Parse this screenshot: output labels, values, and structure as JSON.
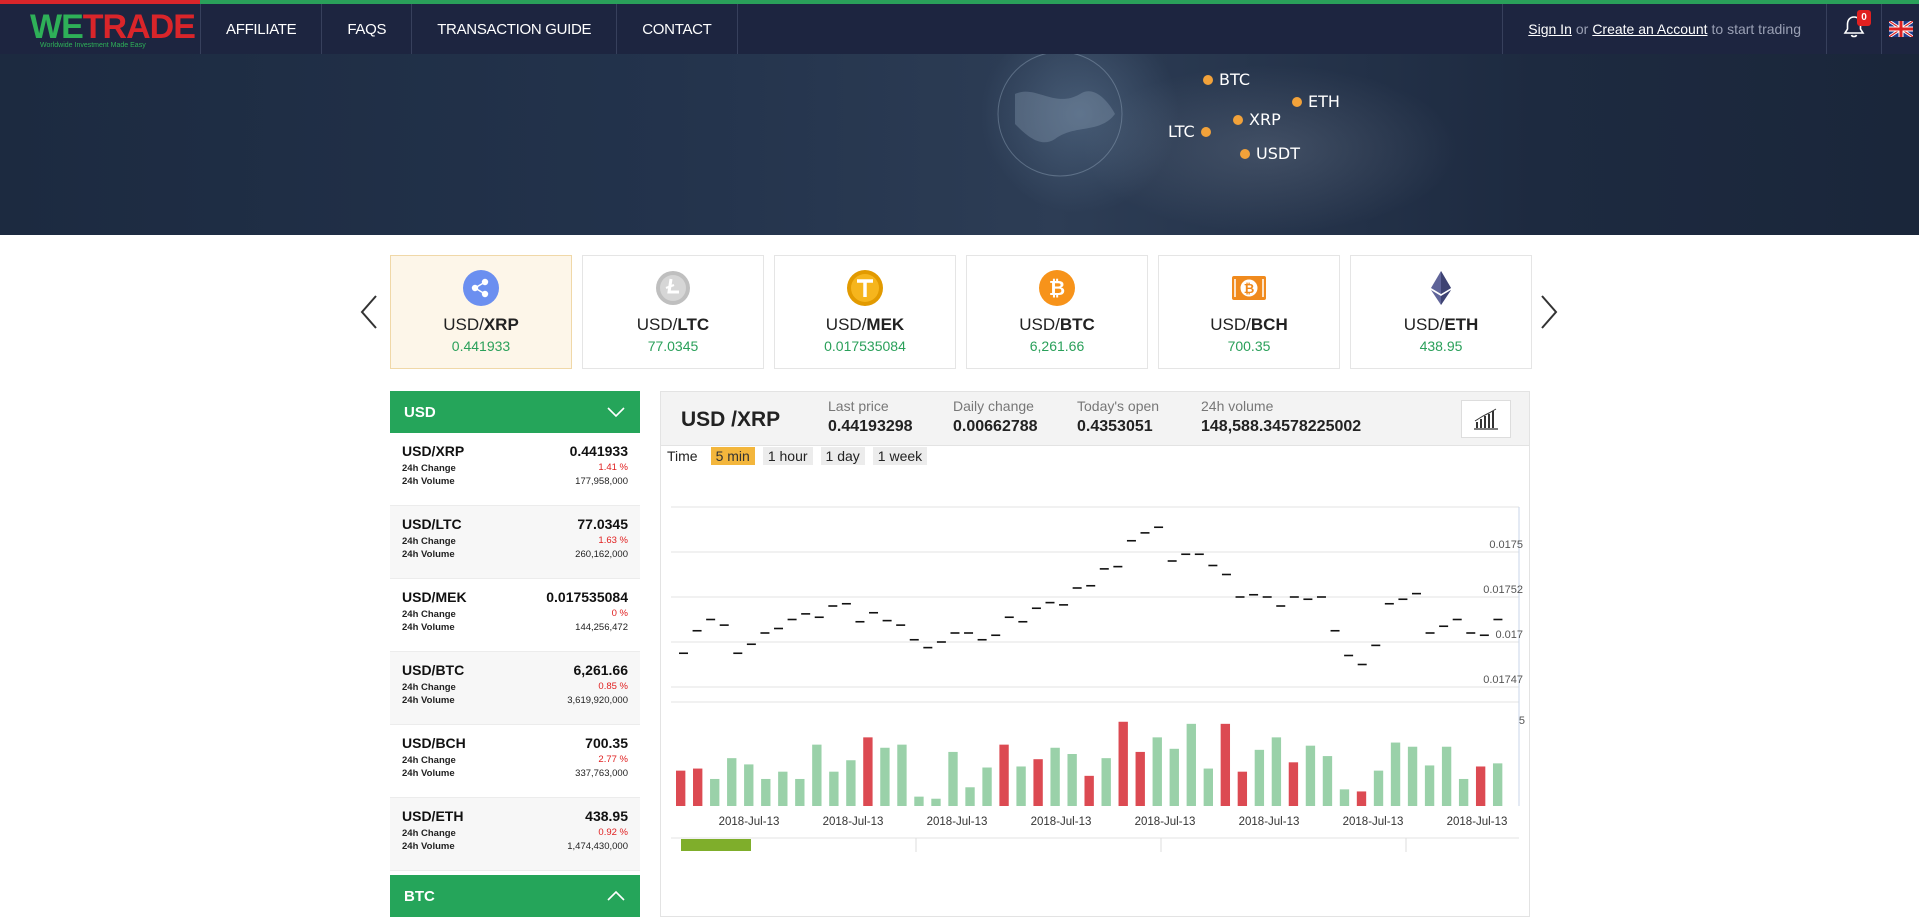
{
  "brand": {
    "logo_w": "WE",
    "logo_trade": "TRADE",
    "tagline": "Worldwide Investment Made Easy"
  },
  "nav": {
    "items": [
      "AFFILIATE",
      "FAQS",
      "TRANSACTION GUIDE",
      "CONTACT"
    ]
  },
  "auth": {
    "signin": "Sign In",
    "or": "or",
    "create": "Create an Account",
    "suffix": "to start trading"
  },
  "notifications": {
    "count": "0"
  },
  "hero": {
    "coins": [
      "BTC",
      "ETH",
      "XRP",
      "LTC",
      "USDT"
    ]
  },
  "tickers": [
    {
      "base": "USD/",
      "quote": "XRP",
      "price": "0.441933",
      "icon": "xrp-icon",
      "color": "#6b8ff0"
    },
    {
      "base": "USD/",
      "quote": "LTC",
      "price": "77.0345",
      "icon": "ltc-icon",
      "color": "#b7b7b7"
    },
    {
      "base": "USD/",
      "quote": "MEK",
      "price": "0.017535084",
      "icon": "mek-icon",
      "color": "#f2a500"
    },
    {
      "base": "USD/",
      "quote": "BTC",
      "price": "6,261.66",
      "icon": "btc-icon",
      "color": "#f7931a"
    },
    {
      "base": "USD/",
      "quote": "BCH",
      "price": "700.35",
      "icon": "bch-icon",
      "color": "#f7931a"
    },
    {
      "base": "USD/",
      "quote": "ETH",
      "price": "438.95",
      "icon": "eth-icon",
      "color": "#454a75"
    }
  ],
  "market": {
    "usd_header": "USD",
    "btc_header": "BTC",
    "change_label": "24h Change",
    "volume_label": "24h Volume",
    "rows": [
      {
        "pair": "USD/XRP",
        "price": "0.441933",
        "change": "1.41 %",
        "volume": "177,958,000"
      },
      {
        "pair": "USD/LTC",
        "price": "77.0345",
        "change": "1.63 %",
        "volume": "260,162,000"
      },
      {
        "pair": "USD/MEK",
        "price": "0.017535084",
        "change": "0 %",
        "volume": "144,256,472"
      },
      {
        "pair": "USD/BTC",
        "price": "6,261.66",
        "change": "0.85 %",
        "volume": "3,619,920,000"
      },
      {
        "pair": "USD/BCH",
        "price": "700.35",
        "change": "2.77 %",
        "volume": "337,763,000"
      },
      {
        "pair": "USD/ETH",
        "price": "438.95",
        "change": "0.92 %",
        "volume": "1,474,430,000"
      }
    ]
  },
  "panel": {
    "title": "USD /XRP",
    "last_price_label": "Last price",
    "last_price": "0.44193298",
    "daily_change_label": "Daily change",
    "daily_change": "0.00662788",
    "open_label": "Today's open",
    "open": "0.4353051",
    "volume_label": "24h volume",
    "volume": "148,588.34578225002",
    "time_label": "Time",
    "ranges": [
      "5 min",
      "1 hour",
      "1 day",
      "1 week"
    ],
    "selected_range": "5 min"
  },
  "chart_data": {
    "type": "bar",
    "price_ticks": [
      "0.0175",
      "0.01752",
      "0.017",
      "0.01747"
    ],
    "volume_tick": "5",
    "x_labels": [
      "2018-Jul-13",
      "2018-Jul-13",
      "2018-Jul-13",
      "2018-Jul-13",
      "2018-Jul-13",
      "2018-Jul-13",
      "2018-Jul-13",
      "2018-Jul-13"
    ],
    "price_levels": [
      0.3,
      0.5,
      0.6,
      0.55,
      0.3,
      0.38,
      0.48,
      0.52,
      0.6,
      0.65,
      0.62,
      0.72,
      0.74,
      0.58,
      0.66,
      0.59,
      0.55,
      0.42,
      0.35,
      0.4,
      0.48,
      0.48,
      0.42,
      0.46,
      0.62,
      0.58,
      0.7,
      0.75,
      0.73,
      0.88,
      0.9,
      1.05,
      1.07,
      1.3,
      1.37,
      1.42,
      1.12,
      1.18,
      1.18,
      1.08,
      1.0,
      0.8,
      0.82,
      0.8,
      0.72,
      0.8,
      0.78,
      0.8,
      0.5,
      0.28,
      0.2,
      0.37,
      0.74,
      0.78,
      0.83,
      0.48,
      0.54,
      0.6,
      0.48,
      0.46,
      0.6
    ],
    "price_range": [
      0,
      1.6
    ],
    "volumes": [
      {
        "v": 0.34,
        "up": false
      },
      {
        "v": 0.36,
        "up": false
      },
      {
        "v": 0.26,
        "up": true
      },
      {
        "v": 0.46,
        "up": true
      },
      {
        "v": 0.4,
        "up": true
      },
      {
        "v": 0.26,
        "up": true
      },
      {
        "v": 0.33,
        "up": true
      },
      {
        "v": 0.26,
        "up": true
      },
      {
        "v": 0.59,
        "up": true
      },
      {
        "v": 0.33,
        "up": true
      },
      {
        "v": 0.44,
        "up": true
      },
      {
        "v": 0.66,
        "up": false
      },
      {
        "v": 0.56,
        "up": true
      },
      {
        "v": 0.59,
        "up": true
      },
      {
        "v": 0.09,
        "up": true
      },
      {
        "v": 0.07,
        "up": true
      },
      {
        "v": 0.52,
        "up": true
      },
      {
        "v": 0.18,
        "up": true
      },
      {
        "v": 0.37,
        "up": true
      },
      {
        "v": 0.59,
        "up": false
      },
      {
        "v": 0.38,
        "up": true
      },
      {
        "v": 0.45,
        "up": false
      },
      {
        "v": 0.56,
        "up": true
      },
      {
        "v": 0.5,
        "up": true
      },
      {
        "v": 0.29,
        "up": false
      },
      {
        "v": 0.46,
        "up": true
      },
      {
        "v": 0.81,
        "up": false
      },
      {
        "v": 0.52,
        "up": false
      },
      {
        "v": 0.66,
        "up": true
      },
      {
        "v": 0.55,
        "up": true
      },
      {
        "v": 0.79,
        "up": true
      },
      {
        "v": 0.36,
        "up": true
      },
      {
        "v": 0.79,
        "up": false
      },
      {
        "v": 0.33,
        "up": false
      },
      {
        "v": 0.54,
        "up": true
      },
      {
        "v": 0.66,
        "up": true
      },
      {
        "v": 0.42,
        "up": false
      },
      {
        "v": 0.58,
        "up": true
      },
      {
        "v": 0.48,
        "up": true
      },
      {
        "v": 0.16,
        "up": true
      },
      {
        "v": 0.14,
        "up": false
      },
      {
        "v": 0.34,
        "up": true
      },
      {
        "v": 0.61,
        "up": true
      },
      {
        "v": 0.57,
        "up": true
      },
      {
        "v": 0.39,
        "up": true
      },
      {
        "v": 0.57,
        "up": true
      },
      {
        "v": 0.26,
        "up": true
      },
      {
        "v": 0.38,
        "up": false
      },
      {
        "v": 0.41,
        "up": true
      }
    ],
    "colors": {
      "up": "#9ad1a9",
      "down": "#dc4a52",
      "price": "#111111"
    }
  },
  "colors": {
    "nav_bg": "#1d2540",
    "green": "#25a55a",
    "red": "#e02020",
    "gold": "#f3b63c"
  }
}
